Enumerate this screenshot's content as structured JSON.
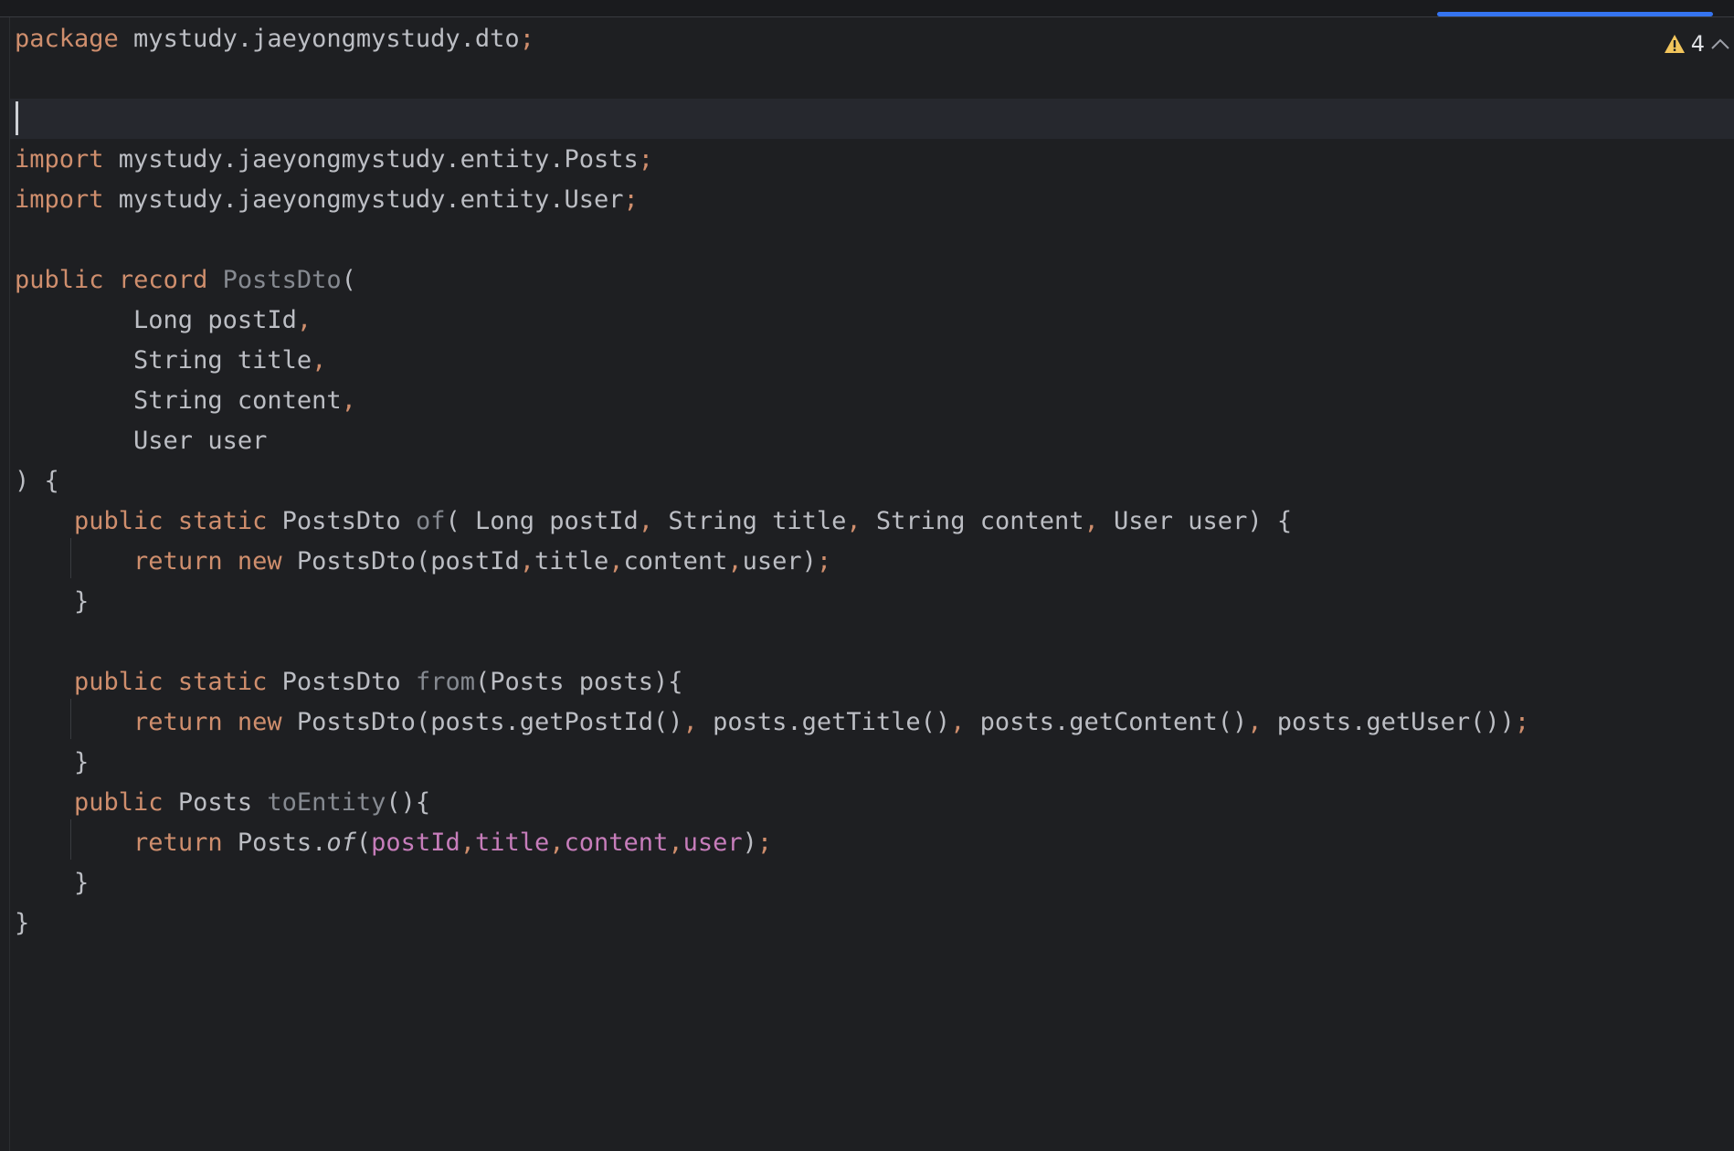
{
  "inspection": {
    "warning_count": "4",
    "warning_color": "#f2c55c"
  },
  "colors": {
    "background": "#1e1f22",
    "keyword": "#cf8e6d",
    "text": "#bcbec4",
    "declaration": "#868a91",
    "field": "#c77dbb",
    "progress": "#3574f0"
  },
  "code": {
    "lines": [
      [
        {
          "t": "package",
          "c": "kw"
        },
        {
          "t": " mystudy.jaeyongmystudy.dto"
        },
        {
          "t": ";",
          "c": "pn"
        }
      ],
      [],
      [],
      [
        {
          "t": "import",
          "c": "kw"
        },
        {
          "t": " mystudy.jaeyongmystudy.entity.Posts"
        },
        {
          "t": ";",
          "c": "pn"
        }
      ],
      [
        {
          "t": "import",
          "c": "kw"
        },
        {
          "t": " mystudy.jaeyongmystudy.entity.User"
        },
        {
          "t": ";",
          "c": "pn"
        }
      ],
      [],
      [
        {
          "t": "public",
          "c": "kw"
        },
        {
          "t": " "
        },
        {
          "t": "record",
          "c": "kw"
        },
        {
          "t": " "
        },
        {
          "t": "PostsDto",
          "c": "fn"
        },
        {
          "t": "("
        }
      ],
      [
        {
          "t": "        Long postId"
        },
        {
          "t": ",",
          "c": "pn"
        }
      ],
      [
        {
          "t": "        String title"
        },
        {
          "t": ",",
          "c": "pn"
        }
      ],
      [
        {
          "t": "        String content"
        },
        {
          "t": ",",
          "c": "pn"
        }
      ],
      [
        {
          "t": "        User user"
        }
      ],
      [
        {
          "t": ") {"
        }
      ],
      [
        {
          "t": "    "
        },
        {
          "t": "public",
          "c": "kw"
        },
        {
          "t": " "
        },
        {
          "t": "static",
          "c": "kw"
        },
        {
          "t": " PostsDto "
        },
        {
          "t": "of",
          "c": "fn"
        },
        {
          "t": "( Long postId"
        },
        {
          "t": ",",
          "c": "pn"
        },
        {
          "t": " String title"
        },
        {
          "t": ",",
          "c": "pn"
        },
        {
          "t": " String content"
        },
        {
          "t": ",",
          "c": "pn"
        },
        {
          "t": " User user) {"
        }
      ],
      [
        {
          "t": "        "
        },
        {
          "t": "return",
          "c": "kw"
        },
        {
          "t": " "
        },
        {
          "t": "new",
          "c": "kw"
        },
        {
          "t": " PostsDto(postId"
        },
        {
          "t": ",",
          "c": "pn"
        },
        {
          "t": "title"
        },
        {
          "t": ",",
          "c": "pn"
        },
        {
          "t": "content"
        },
        {
          "t": ",",
          "c": "pn"
        },
        {
          "t": "user)"
        },
        {
          "t": ";",
          "c": "pn"
        }
      ],
      [
        {
          "t": "    }"
        }
      ],
      [],
      [
        {
          "t": "    "
        },
        {
          "t": "public",
          "c": "kw"
        },
        {
          "t": " "
        },
        {
          "t": "static",
          "c": "kw"
        },
        {
          "t": " PostsDto "
        },
        {
          "t": "from",
          "c": "fn"
        },
        {
          "t": "(Posts posts){"
        }
      ],
      [
        {
          "t": "        "
        },
        {
          "t": "return",
          "c": "kw"
        },
        {
          "t": " "
        },
        {
          "t": "new",
          "c": "kw"
        },
        {
          "t": " PostsDto(posts.getPostId()"
        },
        {
          "t": ",",
          "c": "pn"
        },
        {
          "t": " posts.getTitle()"
        },
        {
          "t": ",",
          "c": "pn"
        },
        {
          "t": " posts.getContent()"
        },
        {
          "t": ",",
          "c": "pn"
        },
        {
          "t": " posts.getUser())"
        },
        {
          "t": ";",
          "c": "pn"
        }
      ],
      [
        {
          "t": "    }"
        }
      ],
      [
        {
          "t": "    "
        },
        {
          "t": "public",
          "c": "kw"
        },
        {
          "t": " Posts "
        },
        {
          "t": "toEntity",
          "c": "fn"
        },
        {
          "t": "(){"
        }
      ],
      [
        {
          "t": "        "
        },
        {
          "t": "return",
          "c": "kw"
        },
        {
          "t": " Posts."
        },
        {
          "t": "of",
          "c": "st"
        },
        {
          "t": "("
        },
        {
          "t": "postId",
          "c": "fld"
        },
        {
          "t": ",",
          "c": "pn"
        },
        {
          "t": "title",
          "c": "fld"
        },
        {
          "t": ",",
          "c": "pn"
        },
        {
          "t": "content",
          "c": "fld"
        },
        {
          "t": ",",
          "c": "pn"
        },
        {
          "t": "user",
          "c": "fld"
        },
        {
          "t": ")"
        },
        {
          "t": ";",
          "c": "pn"
        }
      ],
      [
        {
          "t": "    }"
        }
      ],
      [
        {
          "t": "}"
        }
      ]
    ]
  }
}
